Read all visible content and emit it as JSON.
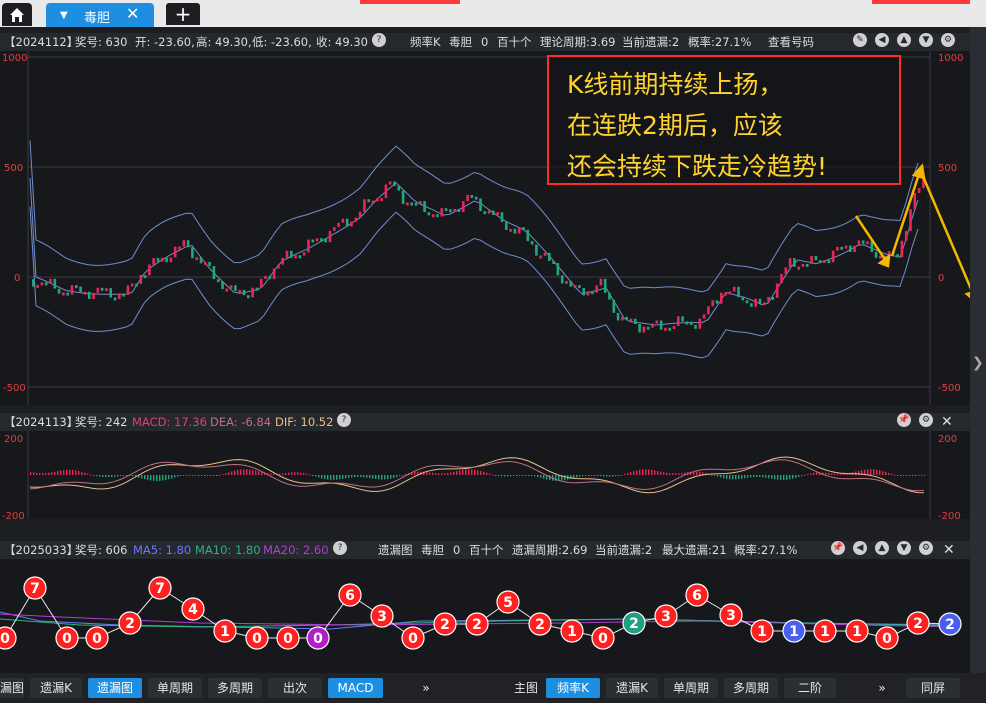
{
  "tabs": {
    "active": "毒胆",
    "add": "+"
  },
  "main": {
    "period": "【2024112】",
    "prize": "奖号: 630",
    "open": "开: -23.60,",
    "high": "高: 49.30,",
    "low": "低: -23.60,",
    "close": "收: 49.30",
    "chart_name": "频率K",
    "indicator": "毒胆",
    "indicator_val": "0",
    "group": "百十个",
    "cycle": "理论周期:3.69",
    "current_miss": "当前遗漏:2",
    "prob": "概率:27.1%",
    "view_btn": "查看号码",
    "ticks_left": [
      "1000",
      "500",
      "0",
      "-500"
    ],
    "ticks_right": [
      "1000",
      "500",
      "0",
      "-500"
    ]
  },
  "macd": {
    "period": "【2024113】",
    "prize": "奖号: 242",
    "macd": "MACD: 17.36",
    "dea": "DEA: -6.84",
    "dif": "DIF: 10.52",
    "ticks_left": [
      "200",
      "-200"
    ],
    "ticks_right": [
      "200",
      "-200"
    ]
  },
  "miss": {
    "period": "【2025033】",
    "prize": "奖号: 606",
    "ma5": "MA5: 1.80",
    "ma10": "MA10: 1.80",
    "ma20": "MA20: 2.60",
    "chart_name": "遗漏图",
    "indicator": "毒胆",
    "indicator_val": "0",
    "group": "百十个",
    "cycle": "遗漏周期:2.69",
    "current_miss": "当前遗漏:2",
    "max_miss": "最大遗漏:21",
    "prob": "概率:27.1%"
  },
  "annotation": {
    "line1": "K线前期持续上扬，",
    "line2": "在连跌2期后，应该",
    "line3": "还会持续下跌走冷趋势!"
  },
  "bottom": {
    "left": [
      "漏图",
      "遗漏K",
      "遗漏图",
      "单周期",
      "多周期",
      "出次",
      "MACD",
      "»"
    ],
    "right": [
      "主图",
      "频率K",
      "遗漏K",
      "单周期",
      "多周期",
      "二阶",
      "»",
      "同屏"
    ]
  },
  "circles": [
    {
      "n": "0",
      "c": "red"
    },
    {
      "n": "7",
      "c": "red"
    },
    {
      "n": "0",
      "c": "red"
    },
    {
      "n": "0",
      "c": "red"
    },
    {
      "n": "2",
      "c": "red"
    },
    {
      "n": "7",
      "c": "red"
    },
    {
      "n": "4",
      "c": "red"
    },
    {
      "n": "1",
      "c": "red"
    },
    {
      "n": "0",
      "c": "red"
    },
    {
      "n": "0",
      "c": "red"
    },
    {
      "n": "0",
      "c": "purple"
    },
    {
      "n": "6",
      "c": "red"
    },
    {
      "n": "3",
      "c": "red"
    },
    {
      "n": "0",
      "c": "red"
    },
    {
      "n": "2",
      "c": "red"
    },
    {
      "n": "2",
      "c": "red"
    },
    {
      "n": "5",
      "c": "red"
    },
    {
      "n": "2",
      "c": "red"
    },
    {
      "n": "1",
      "c": "red"
    },
    {
      "n": "0",
      "c": "red"
    },
    {
      "n": "2",
      "c": "green"
    },
    {
      "n": "3",
      "c": "red"
    },
    {
      "n": "6",
      "c": "red"
    },
    {
      "n": "3",
      "c": "red"
    },
    {
      "n": "1",
      "c": "red"
    },
    {
      "n": "1",
      "c": "blue"
    },
    {
      "n": "1",
      "c": "red"
    },
    {
      "n": "1",
      "c": "red"
    },
    {
      "n": "0",
      "c": "red"
    },
    {
      "n": "2",
      "c": "red"
    },
    {
      "n": "2",
      "c": "blue"
    }
  ],
  "colors": {
    "up": "#e8265a",
    "down": "#1fa87a",
    "band": "#6f8fd0",
    "accent": "#1e8fe0",
    "ann": "#ffd22e"
  }
}
